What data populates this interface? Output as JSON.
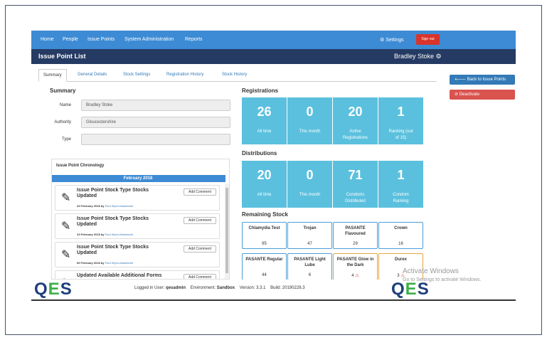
{
  "nav": {
    "items": [
      "Home",
      "People",
      "Issue Points",
      "System Administration",
      "Reports"
    ],
    "settings": "Settings",
    "signout": "Sign out"
  },
  "title": "Issue Point List",
  "location": "Bradley Stoke",
  "tabs": [
    "Summary",
    "General Details",
    "Stock Settings",
    "Registration History",
    "Stock History"
  ],
  "sidebar": {
    "back": "Back to Issue Points",
    "deactivate": "Deactivate"
  },
  "summary": {
    "heading": "Summary",
    "name_label": "Name",
    "name_value": "Bradley Stoke",
    "authority_label": "Authority",
    "authority_value": "Gloucestershire",
    "type_label": "Type",
    "type_value": ""
  },
  "chronology": {
    "heading": "Issue Point Chronology",
    "month": "February 2018",
    "add_label": "Add Comment",
    "entries": [
      {
        "title": "Issue Point Stock Type Stocks Updated",
        "date": "23 February 2018 by",
        "user": "Paul Wynn-Mackenzie"
      },
      {
        "title": "Issue Point Stock Type Stocks Updated",
        "date": "23 February 2018 by",
        "user": "Paul Wynn-Mackenzie"
      },
      {
        "title": "Issue Point Stock Type Stocks Updated",
        "date": "06 February 2018 by",
        "user": "Paul Wynn-Mackenzie"
      },
      {
        "title": "Updated Available Additional Forms",
        "date": "",
        "user": ""
      }
    ]
  },
  "registrations": {
    "heading": "Registrations",
    "tiles": [
      {
        "value": "26",
        "caption": "All time"
      },
      {
        "value": "0",
        "caption": "This month"
      },
      {
        "value": "20",
        "caption": "Active Registrations"
      },
      {
        "value": "1",
        "caption": "Ranking (out of 15)"
      }
    ]
  },
  "distributions": {
    "heading": "Distributions",
    "tiles": [
      {
        "value": "20",
        "caption": "All time"
      },
      {
        "value": "0",
        "caption": "This month"
      },
      {
        "value": "71",
        "caption": "Condoms Distributed"
      },
      {
        "value": "1",
        "caption": "Condom Ranking"
      }
    ]
  },
  "stock": {
    "heading": "Remaining Stock",
    "items": [
      {
        "name": "Chlamydia Test",
        "qty": "95"
      },
      {
        "name": "Trojan",
        "qty": "47"
      },
      {
        "name": "PASANTE Flavoured",
        "qty": "29"
      },
      {
        "name": "Crown",
        "qty": "16"
      },
      {
        "name": "PASANTE Regular",
        "qty": "44"
      },
      {
        "name": "PASANTE Light Lube",
        "qty": "6"
      },
      {
        "name": "PASANTE Glow in the Dark",
        "qty": "4"
      },
      {
        "name": "Durex",
        "qty": "3"
      }
    ]
  },
  "footer": {
    "logo_q": "Q",
    "logo_e": "E",
    "logo_s": "S",
    "user_label": "Logged in User:",
    "user": "qesadmin",
    "env_label": "Environment:",
    "env": "Sandbox",
    "version_label": "Version:",
    "version": "3.3.1",
    "build_label": "Build:",
    "build": "20190228.3"
  },
  "watermark": {
    "line1": "Activate Windows",
    "line2": "Go to Settings to activate Windows."
  },
  "colors": {
    "nav": "#3d8bd4",
    "titlebar": "#253b63",
    "tile": "#5bc0de",
    "danger": "#d9534f",
    "primary": "#337ab7"
  }
}
